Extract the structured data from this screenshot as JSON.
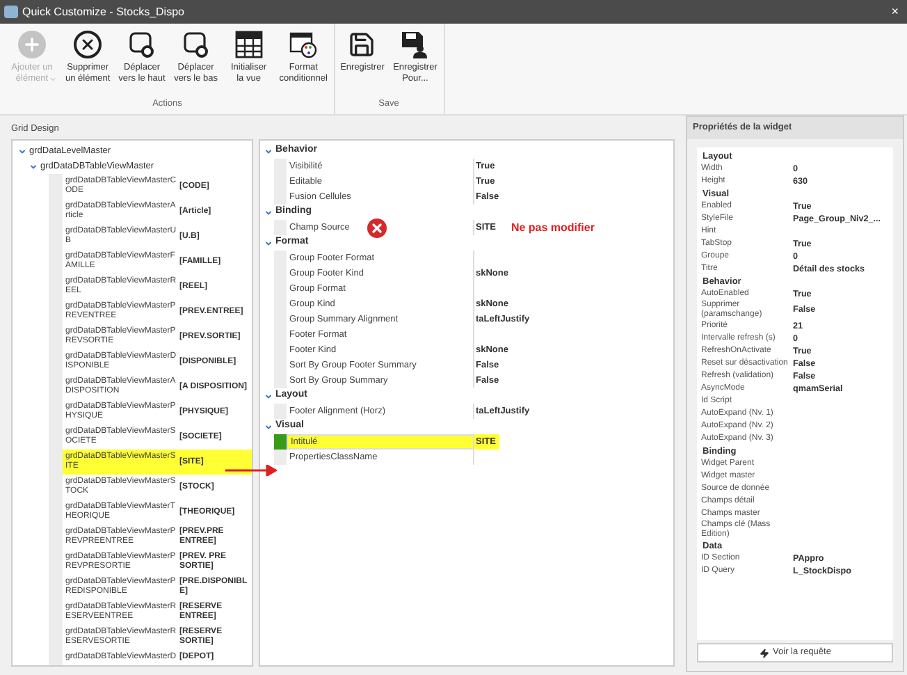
{
  "window": {
    "title": "Quick Customize - Stocks_Dispo",
    "close": "×"
  },
  "toolbar": {
    "groups": [
      {
        "label": "Actions",
        "buttons": [
          {
            "kind": "add",
            "label": "Ajouter un\nélément",
            "disabled": true,
            "dropdown": true
          },
          {
            "kind": "delete",
            "label": "Supprimer\nun élément",
            "disabled": false,
            "dropdown": false
          },
          {
            "kind": "up",
            "label": "Déplacer\nvers le haut",
            "disabled": false,
            "dropdown": false
          },
          {
            "kind": "down",
            "label": "Déplacer\nvers le bas",
            "disabled": false,
            "dropdown": false
          },
          {
            "kind": "table",
            "label": "Initialiser\nla vue",
            "disabled": false,
            "dropdown": false
          },
          {
            "kind": "format",
            "label": "Format\nconditionnel",
            "disabled": false,
            "dropdown": false
          }
        ]
      },
      {
        "label": "Save",
        "buttons": [
          {
            "kind": "save",
            "label": "Enregistrer",
            "disabled": false,
            "dropdown": false
          },
          {
            "kind": "saveas",
            "label": "Enregistrer\nPour...",
            "disabled": false,
            "dropdown": false
          }
        ]
      }
    ]
  },
  "grid_design": {
    "label": "Grid Design",
    "tree": [
      {
        "name": "grdDataLevelMaster",
        "expanded": true,
        "children": [
          {
            "name": "grdDataDBTableViewMaster",
            "expanded": true,
            "children": [
              {
                "name": "grdDataDBTableViewMasterCODE",
                "value": "[CODE]",
                "selected": false
              },
              {
                "name": "grdDataDBTableViewMasterArticle",
                "value": "[Article]",
                "selected": false
              },
              {
                "name": "grdDataDBTableViewMasterUB",
                "value": "[U.B]",
                "selected": false
              },
              {
                "name": "grdDataDBTableViewMasterFAMILLE",
                "value": "[FAMILLE]",
                "selected": false
              },
              {
                "name": "grdDataDBTableViewMasterREEL",
                "value": "[REEL]",
                "selected": false
              },
              {
                "name": "grdDataDBTableViewMasterPREVENTREE",
                "value": "[PREV.ENTREE]",
                "selected": false
              },
              {
                "name": "grdDataDBTableViewMasterPREVSORTIE",
                "value": "[PREV.SORTIE]",
                "selected": false
              },
              {
                "name": "grdDataDBTableViewMasterDISPONIBLE",
                "value": "[DISPONIBLE]",
                "selected": false
              },
              {
                "name": "grdDataDBTableViewMasterADISPOSITION",
                "value": "[A DISPOSITION]",
                "selected": false
              },
              {
                "name": "grdDataDBTableViewMasterPHYSIQUE",
                "value": "[PHYSIQUE]",
                "selected": false
              },
              {
                "name": "grdDataDBTableViewMasterSOCIETE",
                "value": "[SOCIETE]",
                "selected": false
              },
              {
                "name": "grdDataDBTableViewMasterSITE",
                "value": "[SITE]",
                "selected": true
              },
              {
                "name": "grdDataDBTableViewMasterSTOCK",
                "value": "[STOCK]",
                "selected": false
              },
              {
                "name": "grdDataDBTableViewMasterTHEORIQUE",
                "value": "[THEORIQUE]",
                "selected": false
              },
              {
                "name": "grdDataDBTableViewMasterPREVPREENTREE",
                "value": "[PREV.PRE ENTREE]",
                "selected": false
              },
              {
                "name": "grdDataDBTableViewMasterPREVPRESORTIE",
                "value": "[PREV. PRE SORTIE]",
                "selected": false
              },
              {
                "name": "grdDataDBTableViewMasterPREDISPONIBLE",
                "value": "[PRE.DISPONIBLE]",
                "selected": false
              },
              {
                "name": "grdDataDBTableViewMasterRESERVEENTREE",
                "value": "[RESERVE ENTREE]",
                "selected": false
              },
              {
                "name": "grdDataDBTableViewMasterRESERVESORTIE",
                "value": "[RESERVE SORTIE]",
                "selected": false
              },
              {
                "name": "grdDataDBTableViewMasterD",
                "value": "[DEPOT]",
                "selected": false
              }
            ]
          }
        ]
      }
    ]
  },
  "column_properties": [
    {
      "category": "Behavior",
      "expanded": true,
      "rows": [
        {
          "name": "Visibilité",
          "value": "True",
          "selected": false
        },
        {
          "name": "Editable",
          "value": "True",
          "selected": false
        },
        {
          "name": "Fusion Cellules",
          "value": "False",
          "selected": false
        }
      ]
    },
    {
      "category": "Binding",
      "expanded": true,
      "rows": [
        {
          "name": "Champ Source",
          "value": "SITE",
          "selected": false,
          "warning": "Ne pas modifier"
        }
      ]
    },
    {
      "category": "Format",
      "expanded": true,
      "rows": [
        {
          "name": "Group Footer Format",
          "value": "",
          "selected": false
        },
        {
          "name": "Group Footer Kind",
          "value": "skNone",
          "selected": false
        },
        {
          "name": "Group Format",
          "value": "",
          "selected": false
        },
        {
          "name": "Group Kind",
          "value": "skNone",
          "selected": false
        },
        {
          "name": "Group Summary Alignment",
          "value": "taLeftJustify",
          "selected": false
        },
        {
          "name": "Footer Format",
          "value": "",
          "selected": false
        },
        {
          "name": "Footer Kind",
          "value": "skNone",
          "selected": false
        },
        {
          "name": "Sort By Group Footer Summary",
          "value": "False",
          "selected": false
        },
        {
          "name": "Sort By Group Summary",
          "value": "False",
          "selected": false
        }
      ]
    },
    {
      "category": "Layout",
      "expanded": true,
      "rows": [
        {
          "name": "Footer Alignment (Horz)",
          "value": "taLeftJustify",
          "selected": false
        }
      ]
    },
    {
      "category": "Visual",
      "expanded": true,
      "rows": [
        {
          "name": "Intitulé",
          "value": "SITE",
          "selected": true
        },
        {
          "name": "PropertiesClassName",
          "value": "",
          "selected": false
        }
      ]
    }
  ],
  "widget_properties": {
    "title": "Propriétés de la widget",
    "rows": [
      {
        "kind": "section",
        "label": "Layout"
      },
      {
        "kind": "prop",
        "label": "Width",
        "value": "0"
      },
      {
        "kind": "prop",
        "label": "Height",
        "value": "630"
      },
      {
        "kind": "section",
        "label": "Visual"
      },
      {
        "kind": "prop",
        "label": "Enabled",
        "value": "True"
      },
      {
        "kind": "prop",
        "label": "StyleFile",
        "value": "Page_Group_Niv2_..."
      },
      {
        "kind": "prop",
        "label": "Hint",
        "value": ""
      },
      {
        "kind": "prop",
        "label": "TabStop",
        "value": "True"
      },
      {
        "kind": "prop",
        "label": "Groupe",
        "value": "0"
      },
      {
        "kind": "prop",
        "label": "Titre",
        "value": "Détail des stocks"
      },
      {
        "kind": "section",
        "label": "Behavior"
      },
      {
        "kind": "prop",
        "label": "AutoEnabled",
        "value": "True"
      },
      {
        "kind": "prop",
        "label": "Supprimer (paramschange)",
        "value": "False"
      },
      {
        "kind": "prop",
        "label": "Priorité",
        "value": "21"
      },
      {
        "kind": "prop",
        "label": "Intervalle refresh (s)",
        "value": "0"
      },
      {
        "kind": "prop",
        "label": "RefreshOnActivate",
        "value": "True"
      },
      {
        "kind": "prop",
        "label": "Reset sur désactivation",
        "value": "False"
      },
      {
        "kind": "prop",
        "label": "Refresh (validation)",
        "value": "False"
      },
      {
        "kind": "prop",
        "label": "AsyncMode",
        "value": "qmamSerial"
      },
      {
        "kind": "prop",
        "label": "Id Script",
        "value": ""
      },
      {
        "kind": "prop",
        "label": "AutoExpand (Nv. 1)",
        "value": ""
      },
      {
        "kind": "prop",
        "label": "AutoExpand (Nv. 2)",
        "value": ""
      },
      {
        "kind": "prop",
        "label": "AutoExpand (Nv. 3)",
        "value": ""
      },
      {
        "kind": "section",
        "label": "Binding"
      },
      {
        "kind": "prop",
        "label": "Widget Parent",
        "value": ""
      },
      {
        "kind": "prop",
        "label": "Widget master",
        "value": ""
      },
      {
        "kind": "prop",
        "label": "Source de donnée",
        "value": ""
      },
      {
        "kind": "prop",
        "label": "Champs détail",
        "value": ""
      },
      {
        "kind": "prop",
        "label": "Champs master",
        "value": ""
      },
      {
        "kind": "prop",
        "label": "Champs clé (Mass Edition)",
        "value": ""
      },
      {
        "kind": "section",
        "label": "Data"
      },
      {
        "kind": "prop",
        "label": "ID Section",
        "value": "PAppro"
      },
      {
        "kind": "prop",
        "label": "ID Query",
        "value": "L_StockDispo"
      }
    ],
    "button": "Voir la requête"
  }
}
